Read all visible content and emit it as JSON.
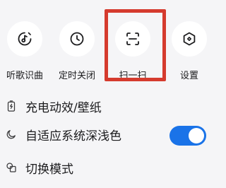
{
  "quick_actions": [
    {
      "label": "听歌识曲",
      "icon": "music-recognize-icon"
    },
    {
      "label": "定时关闭",
      "icon": "clock-icon"
    },
    {
      "label": "扫一扫",
      "icon": "scan-icon"
    },
    {
      "label": "设置",
      "icon": "settings-hexagon-icon"
    }
  ],
  "settings_rows": [
    {
      "label": "充电动效/壁纸",
      "icon": "charging-icon"
    },
    {
      "label": "自适应系统深浅色",
      "icon": "moon-icon",
      "toggle_on": true
    },
    {
      "label": "切换模式",
      "icon": "switch-mode-icon"
    }
  ],
  "colors": {
    "highlight": "#d53b2e",
    "toggle_on": "#1a73e8",
    "background": "#f5f5f7"
  }
}
